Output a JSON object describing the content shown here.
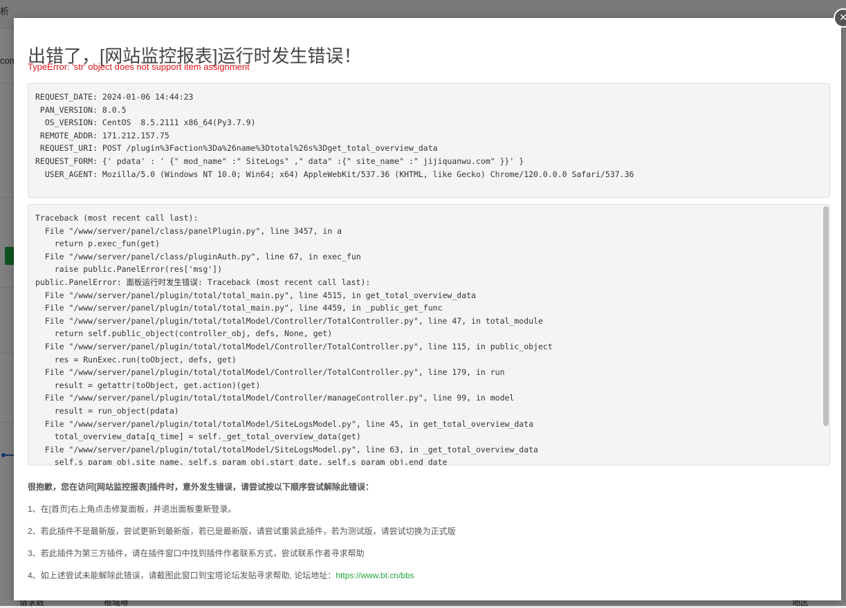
{
  "background": {
    "topbar_text": "析",
    "side_text": "com",
    "bottom_labels": [
      "请求数",
      "根域咻",
      "地区"
    ]
  },
  "modal": {
    "close_symbol": "×",
    "title": "出错了，[网站监控报表]运行时发生错误！",
    "error": "TypeError: 'str' object does not support item assignment",
    "request_info": "REQUEST_DATE: 2024-01-06 14:44:23\n PAN_VERSION: 8.0.5\n  OS_VERSION: CentOS  8.5.2111 x86_64(Py3.7.9)\n REMOTE_ADDR: 171.212.157.75\n REQUEST_URI: POST /plugin%3Faction%3Da%26name%3Dtotal%26s%3Dget_total_overview_data\nREQUEST_FORM: {' pdata' : ' {\" mod_name\" :\" SiteLogs\" ,\" data\" :{\" site_name\" :\" jijiquanwu.com\" }}' }\n  USER_AGENT: Mozilla/5.0 (Windows NT 10.0; Win64; x64) AppleWebKit/537.36 (KHTML, like Gecko) Chrome/120.0.0.0 Safari/537.36",
    "traceback": "Traceback (most recent call last):\n  File \"/www/server/panel/class/panelPlugin.py\", line 3457, in a\n    return p.exec_fun(get)\n  File \"/www/server/panel/class/pluginAuth.py\", line 67, in exec_fun\n    raise public.PanelError(res['msg'])\npublic.PanelError: 面板运行时发生错误: Traceback (most recent call last):\n  File \"/www/server/panel/plugin/total/total_main.py\", line 4515, in get_total_overview_data\n  File \"/www/server/panel/plugin/total/total_main.py\", line 4459, in _public_get_func\n  File \"/www/server/panel/plugin/total/totalModel/Controller/TotalController.py\", line 47, in total_module\n    return self.public_object(controller_obj, defs, None, get)\n  File \"/www/server/panel/plugin/total/totalModel/Controller/TotalController.py\", line 115, in public_object\n    res = RunExec.run(toObject, defs, get)\n  File \"/www/server/panel/plugin/total/totalModel/Controller/TotalController.py\", line 179, in run\n    result = getattr(toObject, get.action)(get)\n  File \"/www/server/panel/plugin/total/totalModel/Controller/manageController.py\", line 99, in model\n    result = run_object(pdata)\n  File \"/www/server/panel/plugin/total/totalModel/SiteLogsModel.py\", line 45, in get_total_overview_data\n    total_overview_data[q_time] = self._get_total_overview_data(get)\n  File \"/www/server/panel/plugin/total/totalModel/SiteLogsModel.py\", line 63, in _get_total_overview_data\n    self.s_param_obj.site_name, self.s_param_obj.start_date, self.s_param_obj.end_date",
    "help_heading": "很抱歉，您在访问[网站监控报表]插件时，意外发生错误，请尝试按以下顺序尝试解除此错误：",
    "help_items": [
      "1、在[首页]右上角点击修复面板，并退出面板重新登录。",
      "2、若此插件不是最新版，尝试更新到最新版，若已是最新版，请尝试重装此插件，若为测试版，请尝试切换为正式版",
      "3、若此插件为第三方插件，请在插件窗口中找到插件作者联系方式，尝试联系作者寻求帮助",
      "4、如上述尝试未能解除此错误，请截图此窗口到宝塔论坛发贴寻求帮助, 论坛地址："
    ],
    "forum_link": "https://www.bt.cn/bbs"
  }
}
